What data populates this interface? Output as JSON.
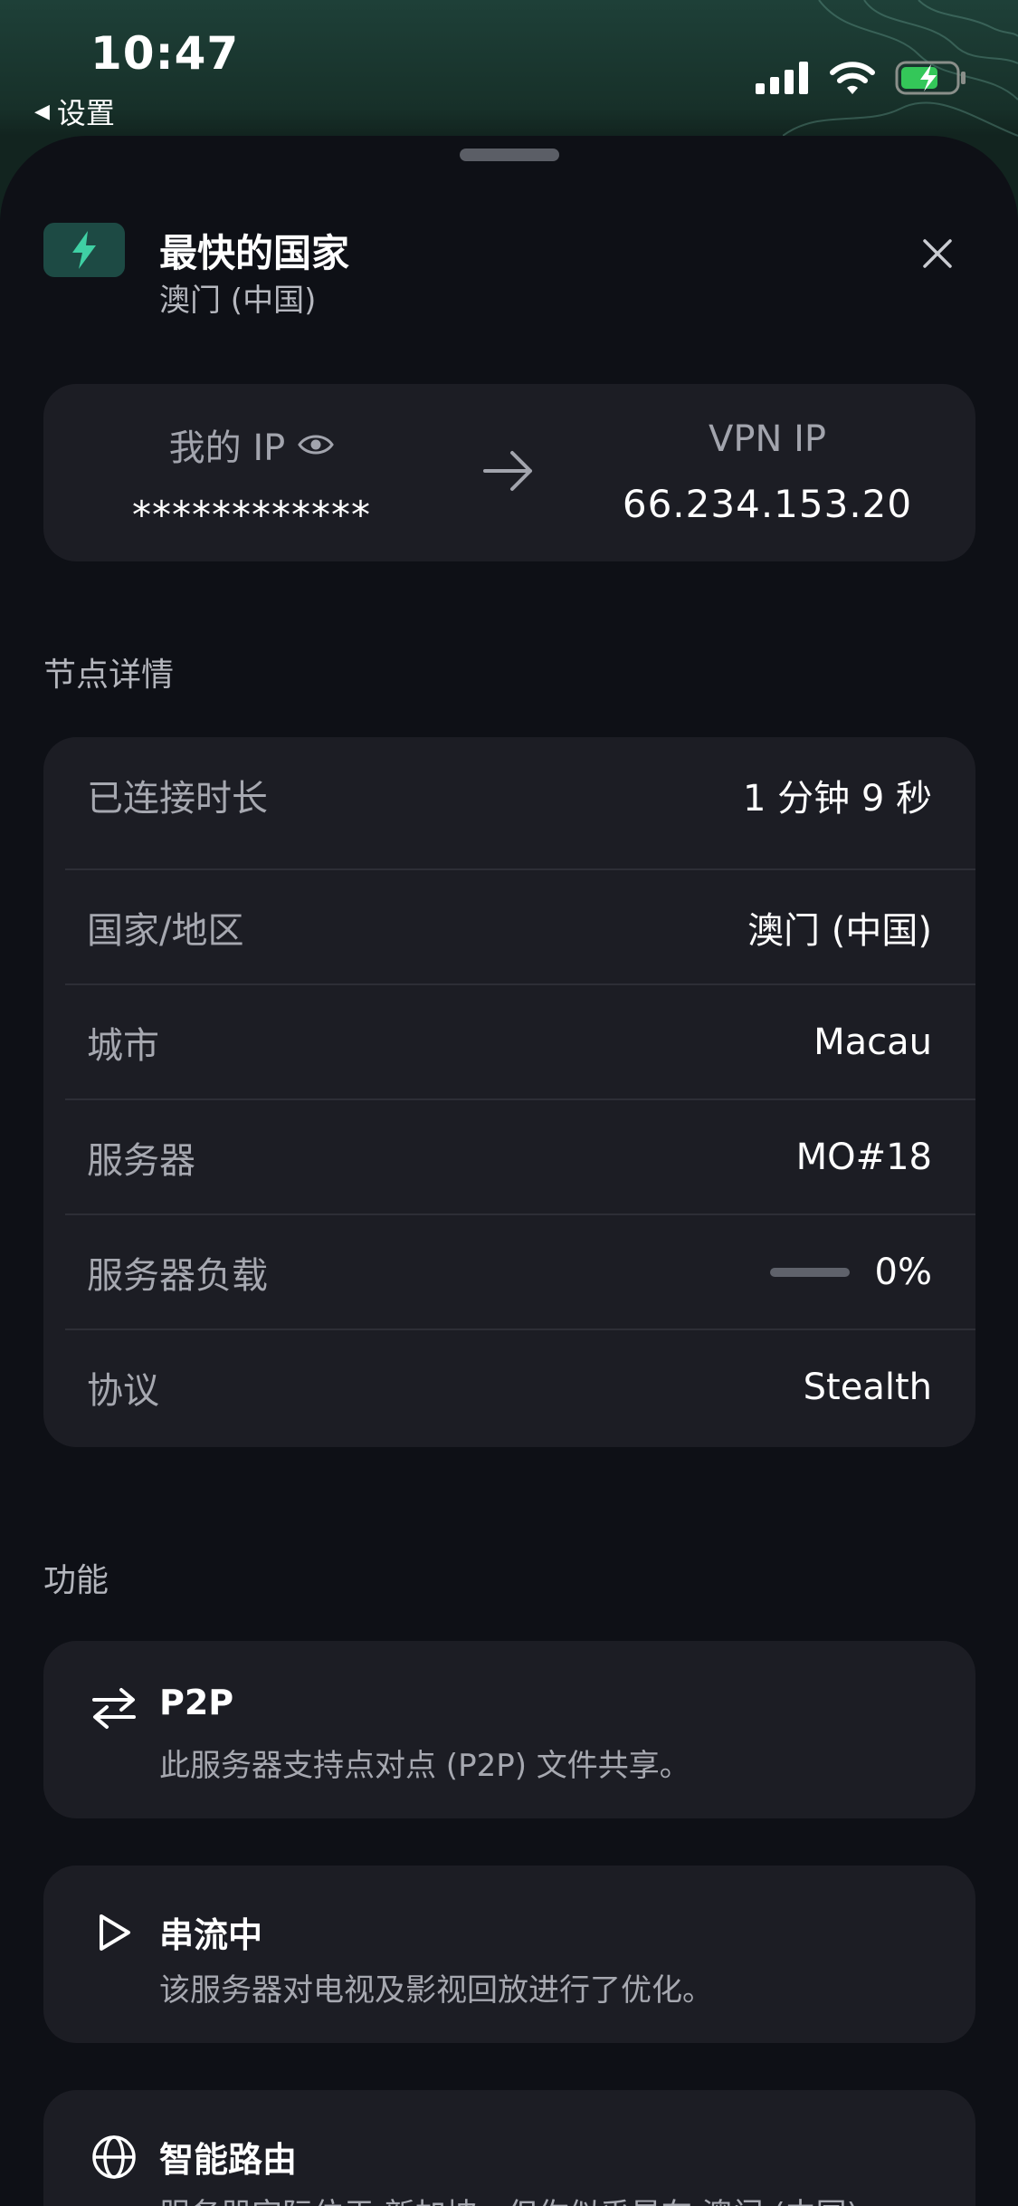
{
  "status_bar": {
    "time": "10:47",
    "back_label": "设置"
  },
  "header": {
    "title": "最快的国家",
    "subtitle": "澳门 (中国)"
  },
  "ip": {
    "my_ip_label": "我的 IP",
    "my_ip_value": "************",
    "vpn_ip_label": "VPN IP",
    "vpn_ip_value": "66.234.153.20"
  },
  "details": {
    "section_label": "节点详情",
    "rows": [
      {
        "label": "已连接时长",
        "value": "1 分钟 9 秒"
      },
      {
        "label": "国家/地区",
        "value": "澳门 (中国)"
      },
      {
        "label": "城市",
        "value": "Macau"
      },
      {
        "label": "服务器",
        "value": "MO#18"
      },
      {
        "label": "服务器负载",
        "value": "0%",
        "load_fraction": 0
      },
      {
        "label": "协议",
        "value": "Stealth"
      }
    ]
  },
  "features": {
    "section_label": "功能",
    "items": [
      {
        "icon": "p2p-arrows-icon",
        "title": "P2P",
        "desc": "此服务器支持点对点 (P2P) 文件共享。"
      },
      {
        "icon": "play-icon",
        "title": "串流中",
        "desc": "该服务器对电视及影视回放进行了优化。"
      },
      {
        "icon": "globe-icon",
        "title": "智能路由",
        "desc": "服务器实际位于 新加坡，但你似乎是在 澳门 (中国)"
      }
    ]
  },
  "colors": {
    "accent": "#3fd0a4",
    "card": "#1c1d24",
    "sheet": "#0e1016",
    "header_bg": "#1c3a34"
  }
}
